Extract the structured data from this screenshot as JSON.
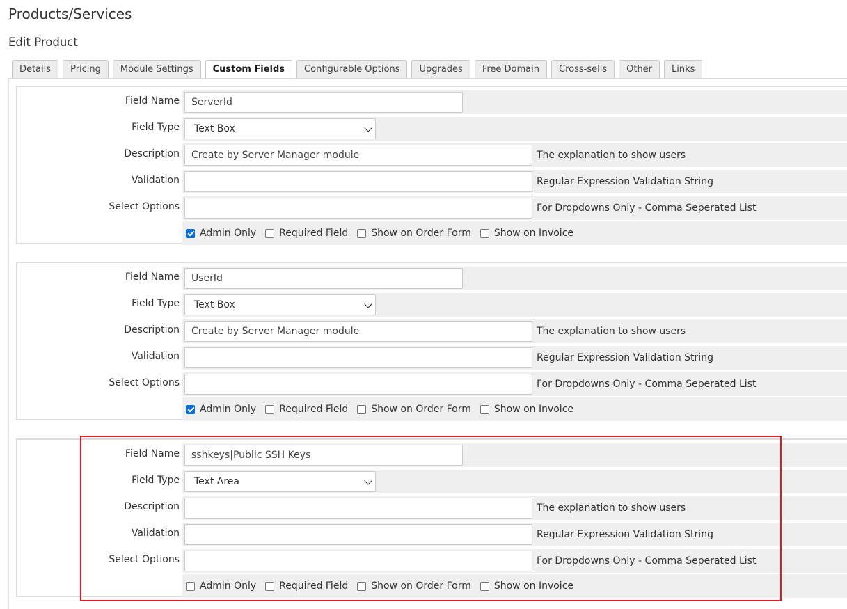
{
  "page": {
    "title": "Products/Services",
    "subtitle": "Edit Product"
  },
  "tabs": [
    {
      "label": "Details"
    },
    {
      "label": "Pricing"
    },
    {
      "label": "Module Settings"
    },
    {
      "label": "Custom Fields",
      "active": true
    },
    {
      "label": "Configurable Options"
    },
    {
      "label": "Upgrades"
    },
    {
      "label": "Free Domain"
    },
    {
      "label": "Cross-sells"
    },
    {
      "label": "Other"
    },
    {
      "label": "Links"
    }
  ],
  "labels": {
    "field_name": "Field Name",
    "field_type": "Field Type",
    "description": "Description",
    "validation": "Validation",
    "select_options": "Select Options"
  },
  "hints": {
    "description": "The explanation to show users",
    "validation": "Regular Expression Validation String",
    "select_options": "For Dropdowns Only - Comma Seperated List"
  },
  "checkbox_labels": {
    "admin_only": "Admin Only",
    "required_field": "Required Field",
    "show_on_order_form": "Show on Order Form",
    "show_on_invoice": "Show on Invoice"
  },
  "fields": [
    {
      "field_name": "ServerId",
      "field_type": "Text Box",
      "description": "Create by Server Manager module",
      "validation": "",
      "select_options": "",
      "admin_only": true,
      "required_field": false,
      "show_on_order_form": false,
      "show_on_invoice": false
    },
    {
      "field_name": "UserId",
      "field_type": "Text Box",
      "description": "Create by Server Manager module",
      "validation": "",
      "select_options": "",
      "admin_only": true,
      "required_field": false,
      "show_on_order_form": false,
      "show_on_invoice": false
    },
    {
      "field_name": "sshkeys|Public SSH Keys",
      "field_type": "Text Area",
      "description": "",
      "validation": "",
      "select_options": "",
      "admin_only": false,
      "required_field": false,
      "show_on_order_form": false,
      "show_on_invoice": false,
      "highlighted": true
    }
  ],
  "colors": {
    "highlight": "#e01b24",
    "checkbox_checked": "#0a70d8",
    "row_bg": "#efefef"
  }
}
